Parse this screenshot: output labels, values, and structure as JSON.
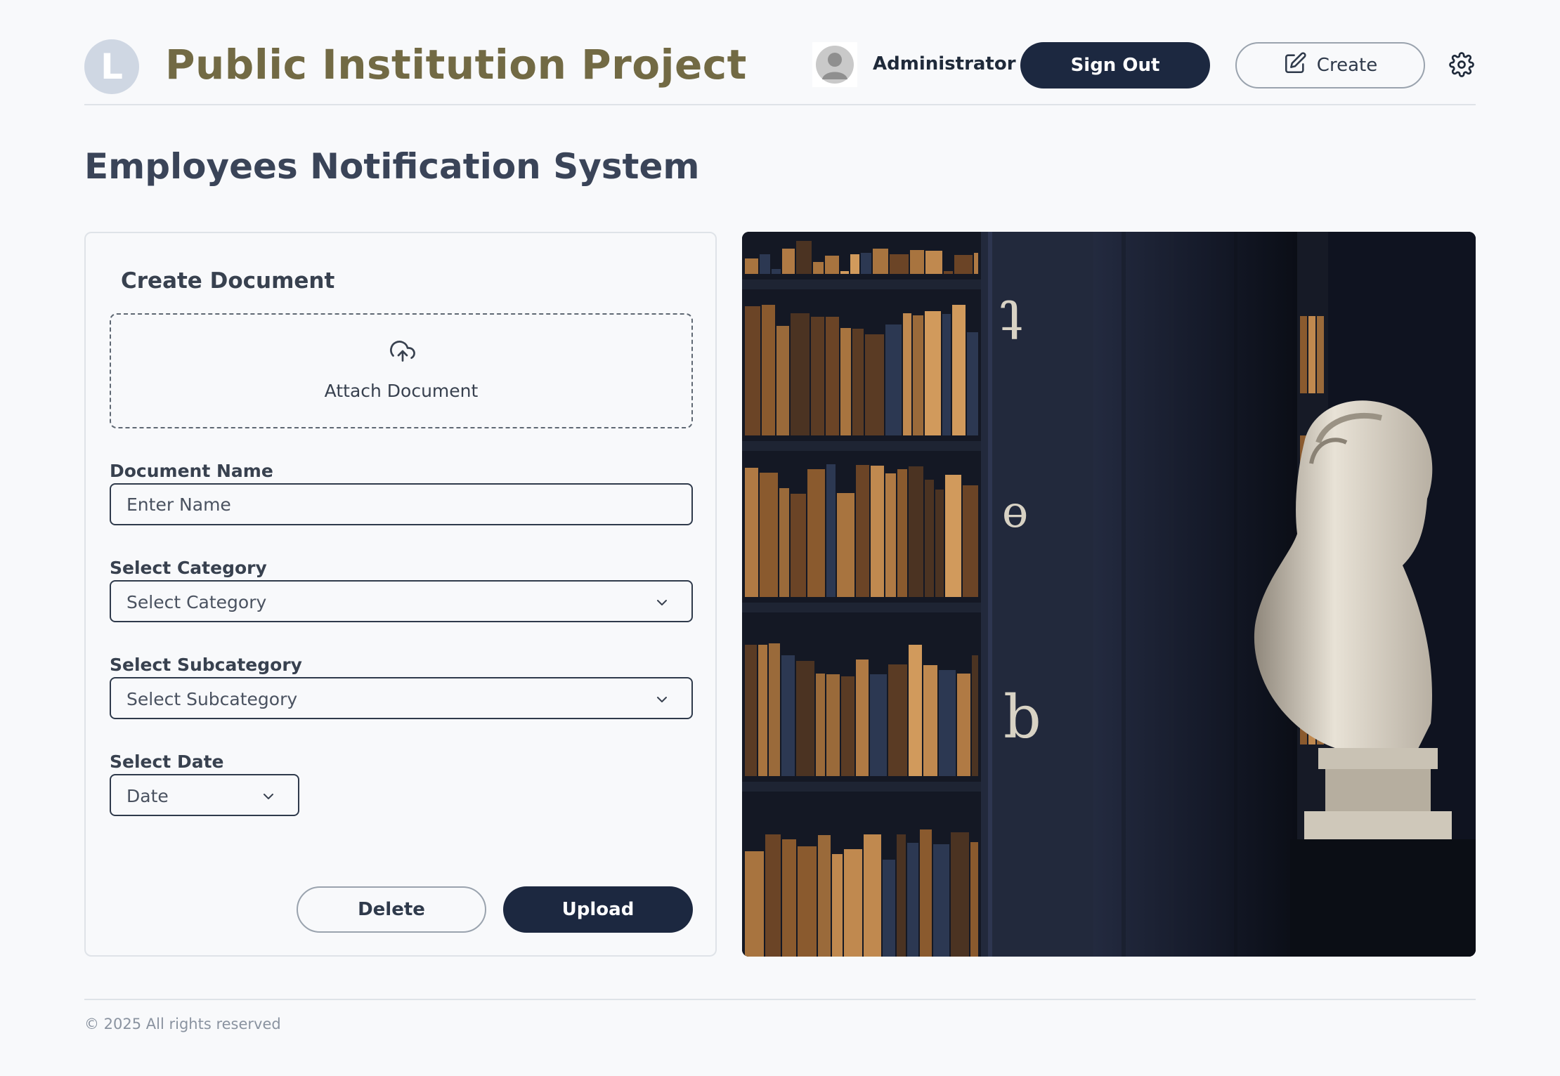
{
  "header": {
    "logo_letter": "L",
    "app_title": "Public Institution Project",
    "user_name": "Administrator",
    "sign_out_label": "Sign Out",
    "create_label": "Create"
  },
  "page": {
    "title": "Employees Notification System"
  },
  "form": {
    "card_title": "Create Document",
    "attach_label": "Attach Document",
    "name_label": "Document Name",
    "name_placeholder": "Enter Name",
    "name_value": "",
    "category_label": "Select Category",
    "category_selected": "Select Category",
    "subcategory_label": "Select Subcategory",
    "subcategory_selected": "Select Subcategory",
    "date_label": "Select Date",
    "date_selected": "Date",
    "delete_label": "Delete",
    "upload_label": "Upload"
  },
  "footer": {
    "copyright": "© 2025 All rights reserved"
  },
  "colors": {
    "background": "#f8f9fb",
    "primary_dark": "#1c2840",
    "brand_title": "#726a44",
    "logo_circle": "#cfd7e3",
    "border": "#dfe3e8"
  },
  "icons": [
    "user-avatar-icon",
    "pencil-square-icon",
    "gear-icon",
    "cloud-upload-icon",
    "chevron-down-icon"
  ]
}
